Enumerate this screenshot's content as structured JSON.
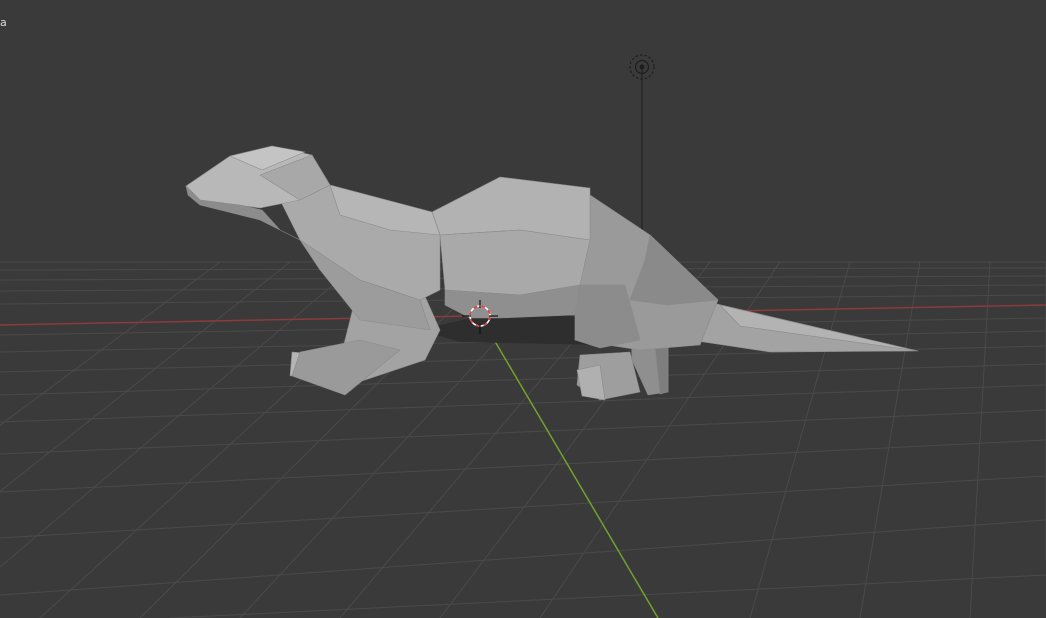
{
  "viewport": {
    "corner_label": "a",
    "colors": {
      "background": "#3a3a3a",
      "grid_line": "#4a4a4a",
      "x_axis": "#8c3a3e",
      "y_axis": "#71a22c",
      "mesh_light": "#a6a6a6",
      "mesh_mid": "#959595",
      "mesh_dark": "#7c7c7c",
      "cursor_red": "#e53b3b"
    },
    "objects": {
      "mesh_name": "otter-mesh",
      "light_icon": "light-icon",
      "cursor_icon": "3d-cursor-icon"
    }
  }
}
